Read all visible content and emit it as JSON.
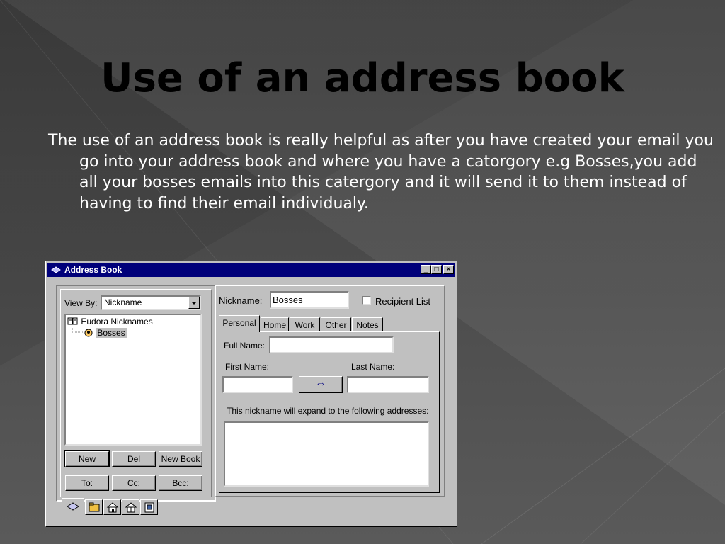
{
  "slide": {
    "title": "Use of an address book",
    "body": "The use of an address book is really helpful as after you have created your email you go into your address book and where you have a catorgory e.g Bosses,you add all your bosses emails into this catergory and it will send it to them instead of having to find their email individualy."
  },
  "window": {
    "title": "Address Book",
    "controls": {
      "minimize": "_",
      "maximize": "□",
      "close": "×"
    },
    "left_panel": {
      "view_by_label": "View By:",
      "view_by_value": "Nickname",
      "tree": {
        "root": "Eudora Nicknames",
        "child": "Bosses"
      },
      "buttons": {
        "new": "New",
        "del": "Del",
        "new_book": "New Book",
        "to": "To:",
        "cc": "Cc:",
        "bcc": "Bcc:"
      }
    },
    "right_panel": {
      "nickname_label": "Nickname:",
      "nickname_value": "Bosses",
      "recipient_list_label": "Recipient List",
      "tabs": [
        "Personal",
        "Home",
        "Work",
        "Other",
        "Notes"
      ],
      "full_name_label": "Full Name:",
      "full_name_value": "",
      "first_name_label": "First Name:",
      "last_name_label": "Last Name:",
      "swap_symbol": "⇔",
      "expand_label": "This nickname will expand to the following addresses:"
    },
    "bottom_tab_icons": [
      "address-book-icon",
      "folder-icon",
      "home-icon",
      "house-gift-icon",
      "document-icon"
    ]
  }
}
